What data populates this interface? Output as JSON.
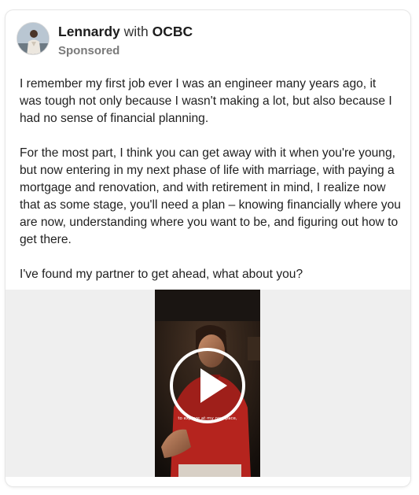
{
  "post": {
    "author": "Lennardy",
    "with_word": "with",
    "partner": "OCBC",
    "label": "Sponsored",
    "avatar": "profile-photo",
    "paragraphs": [
      "I remember my first job ever I was an engineer many years ago, it was tough not only because I wasn't making a lot, but also because I had no sense of financial planning.",
      "For the most part, I think you can get away with it when you're young, but now entering in my next phase of life with marriage, with paying a mortgage and renovation, and with retirement in mind, I realize now that as some stage, you'll need a plan – knowing financially where you are now, understanding where you want to be, and figuring out how to get there.",
      "I've found my partner to get ahead, what about you?"
    ]
  },
  "video": {
    "caption": "to explore at my own pace,",
    "play_icon": "play-icon",
    "media_background": "#efefef",
    "shirt_color": "#b5241e"
  }
}
